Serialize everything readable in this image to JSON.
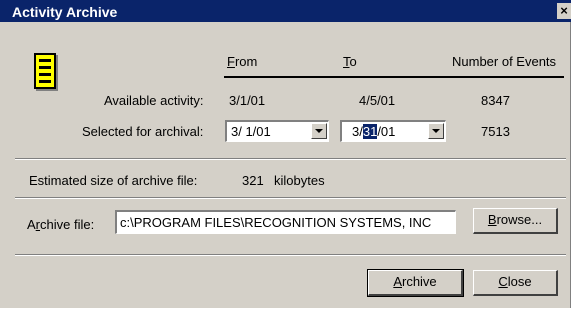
{
  "window": {
    "title": "Activity Archive",
    "close_glyph": "×"
  },
  "icon": "archive-cabinet-icon",
  "columns": {
    "from": "From",
    "to": "To",
    "events": "Number of Events"
  },
  "available": {
    "label": "Available activity:",
    "from": "3/1/01",
    "to": "4/5/01",
    "events": "8347"
  },
  "selected": {
    "label": "Selected for archival:",
    "from": "3/ 1/01",
    "to_prefix": "3/",
    "to_highlight": "31",
    "to_suffix": "/01",
    "events": "7513"
  },
  "estimate": {
    "label": "Estimated size of archive file:",
    "value": "321",
    "unit": "kilobytes"
  },
  "archive_file": {
    "label": "Archive file:",
    "value": "c:\\PROGRAM FILES\\RECOGNITION SYSTEMS, INC"
  },
  "buttons": {
    "browse": "Browse...",
    "archive": "Archive",
    "close": "Close"
  }
}
